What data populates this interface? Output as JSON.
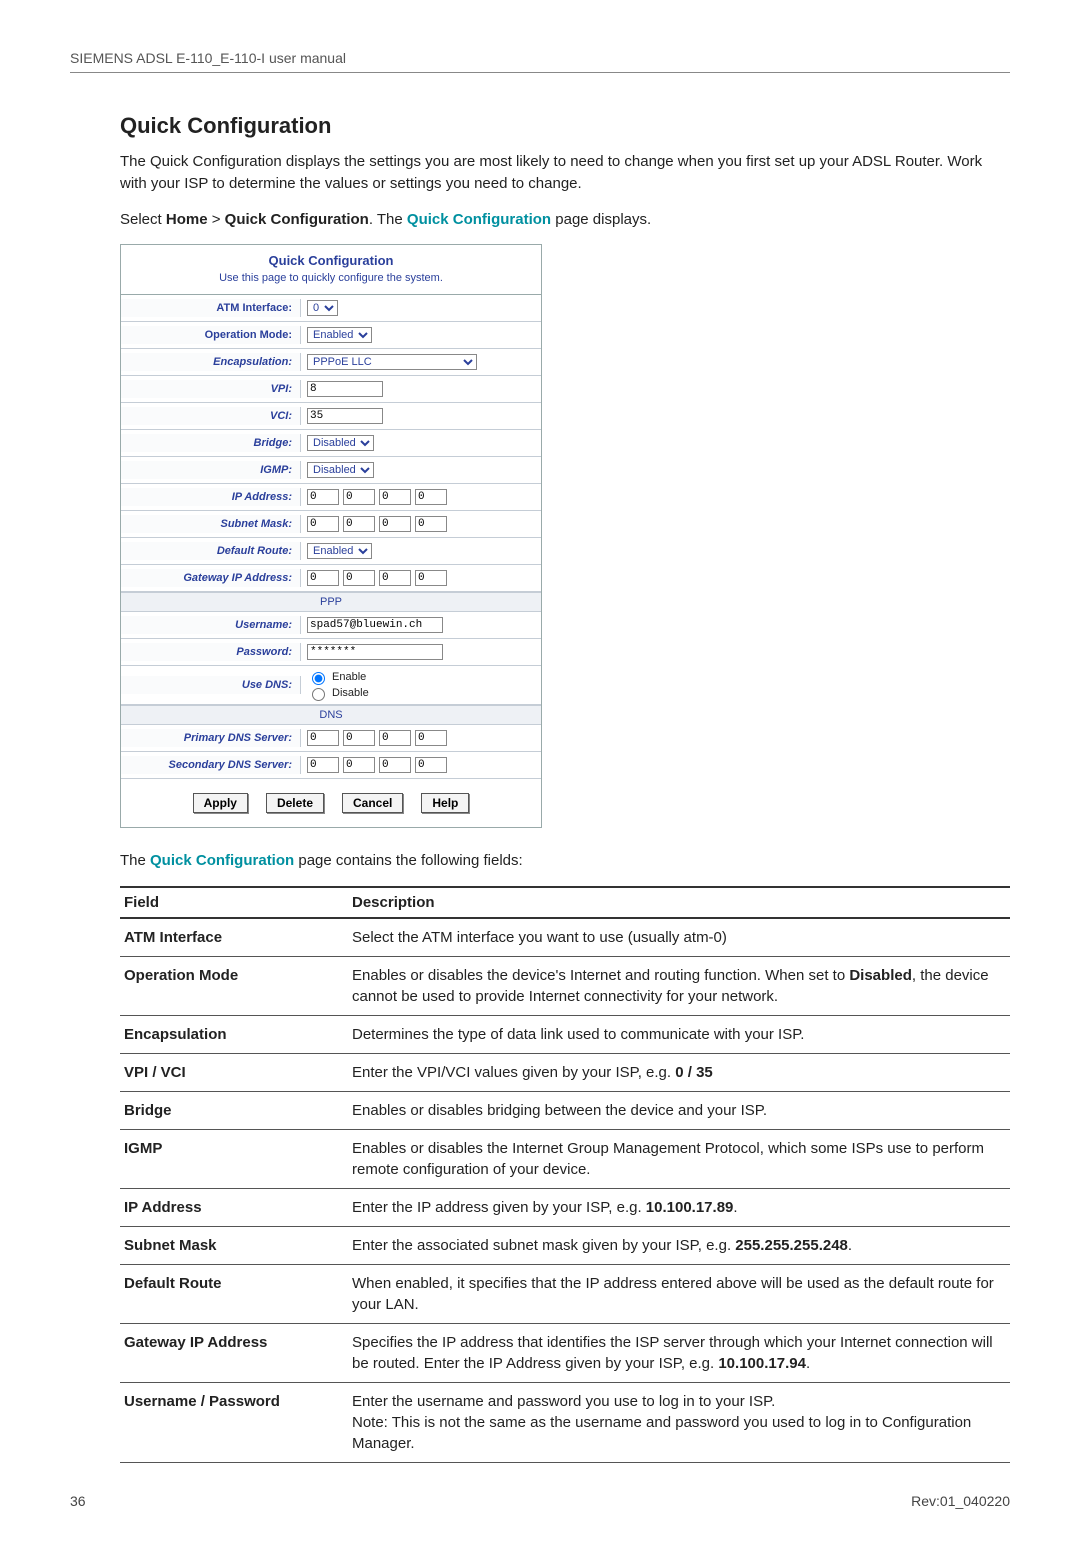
{
  "header": {
    "running": "SIEMENS ADSL E-110_E-110-I user manual"
  },
  "section": {
    "title": "Quick Configuration",
    "intro": "The Quick Configuration displays the settings you are most likely to need to change when you first set up your ADSL Router. Work with your ISP to determine the values or settings you need to change.",
    "nav_prefix": "Select ",
    "nav_home": "Home",
    "nav_gt": " > ",
    "nav_qc": "Quick Configuration",
    "nav_mid": ". The ",
    "nav_link": "Quick Configuration",
    "nav_suffix": " page displays."
  },
  "qc_box": {
    "title": "Quick Configuration",
    "sub": "Use this page to quickly configure the system.",
    "labels": {
      "atm": "ATM Interface:",
      "opmode": "Operation Mode:",
      "encap": "Encapsulation:",
      "vpi": "VPI:",
      "vci": "VCI:",
      "bridge": "Bridge:",
      "igmp": "IGMP:",
      "ip": "IP Address:",
      "subnet": "Subnet Mask:",
      "defroute": "Default Route:",
      "gwip": "Gateway IP Address:",
      "username": "Username:",
      "password": "Password:",
      "usedns": "Use DNS:",
      "pdns": "Primary DNS Server:",
      "sdns": "Secondary DNS Server:"
    },
    "values": {
      "atm": "0",
      "opmode": "Enabled",
      "encap": "PPPoE LLC",
      "vpi": "8",
      "vci": "35",
      "bridge": "Disabled",
      "igmp": "Disabled",
      "ip": [
        "0",
        "0",
        "0",
        "0"
      ],
      "subnet": [
        "0",
        "0",
        "0",
        "0"
      ],
      "defroute": "Enabled",
      "gwip": [
        "0",
        "0",
        "0",
        "0"
      ],
      "username": "spad57@bluewin.ch",
      "password": "*******",
      "dns_enable": "Enable",
      "dns_disable": "Disable",
      "pdns": [
        "0",
        "0",
        "0",
        "0"
      ],
      "sdns": [
        "0",
        "0",
        "0",
        "0"
      ]
    },
    "section_ppp": "PPP",
    "section_dns": "DNS",
    "buttons": {
      "apply": "Apply",
      "delete": "Delete",
      "cancel": "Cancel",
      "help": "Help"
    }
  },
  "tabledesc_prefix": "The ",
  "tabledesc_link": "Quick Configuration",
  "tabledesc_suffix": " page contains the following fields:",
  "field_table": {
    "head_field": "Field",
    "head_desc": "Description",
    "rows": [
      {
        "name": "ATM Interface",
        "desc": "Select the ATM interface you want to use (usually atm-0)"
      },
      {
        "name": "Operation Mode",
        "desc_pre": "Enables or disables the device's Internet and routing function. When set to ",
        "desc_bold": "Disabled",
        "desc_post": ", the device cannot be used to provide Internet connectivity for your network."
      },
      {
        "name": "Encapsulation",
        "desc": "Determines the type of data link used to communicate with your ISP."
      },
      {
        "name": "VPI / VCI",
        "desc_pre": "Enter the VPI/VCI values given by your ISP, e.g. ",
        "desc_bold": "0 / 35"
      },
      {
        "name": "Bridge",
        "desc": "Enables or disables bridging between the device and your ISP."
      },
      {
        "name": "IGMP",
        "desc": "Enables or disables the Internet Group Management Protocol, which some ISPs use to perform remote configuration of your device."
      },
      {
        "name": "IP Address",
        "desc_pre": "Enter the IP address given by your ISP, e.g. ",
        "desc_bold": "10.100.17.89",
        "desc_post": "."
      },
      {
        "name": "Subnet Mask",
        "desc_pre": "Enter the associated subnet mask given by your ISP, e.g. ",
        "desc_bold": "255.255.255.248",
        "desc_post": "."
      },
      {
        "name": "Default Route",
        "desc": "When enabled, it specifies that the IP address entered above will be used as the default route for your LAN."
      },
      {
        "name": "Gateway IP Address",
        "desc_pre": "Specifies the IP address that identifies the ISP server through which your Internet connection will be routed. Enter the IP Address given by your ISP, e.g. ",
        "desc_bold": "10.100.17.94",
        "desc_post": "."
      },
      {
        "name": "Username / Password",
        "desc": "Enter the username and password you use to log in to your ISP.\nNote: This is not the same as the username and password you used to log in to Configuration Manager."
      }
    ]
  },
  "footer": {
    "page": "36",
    "rev": "Rev:01_040220"
  }
}
